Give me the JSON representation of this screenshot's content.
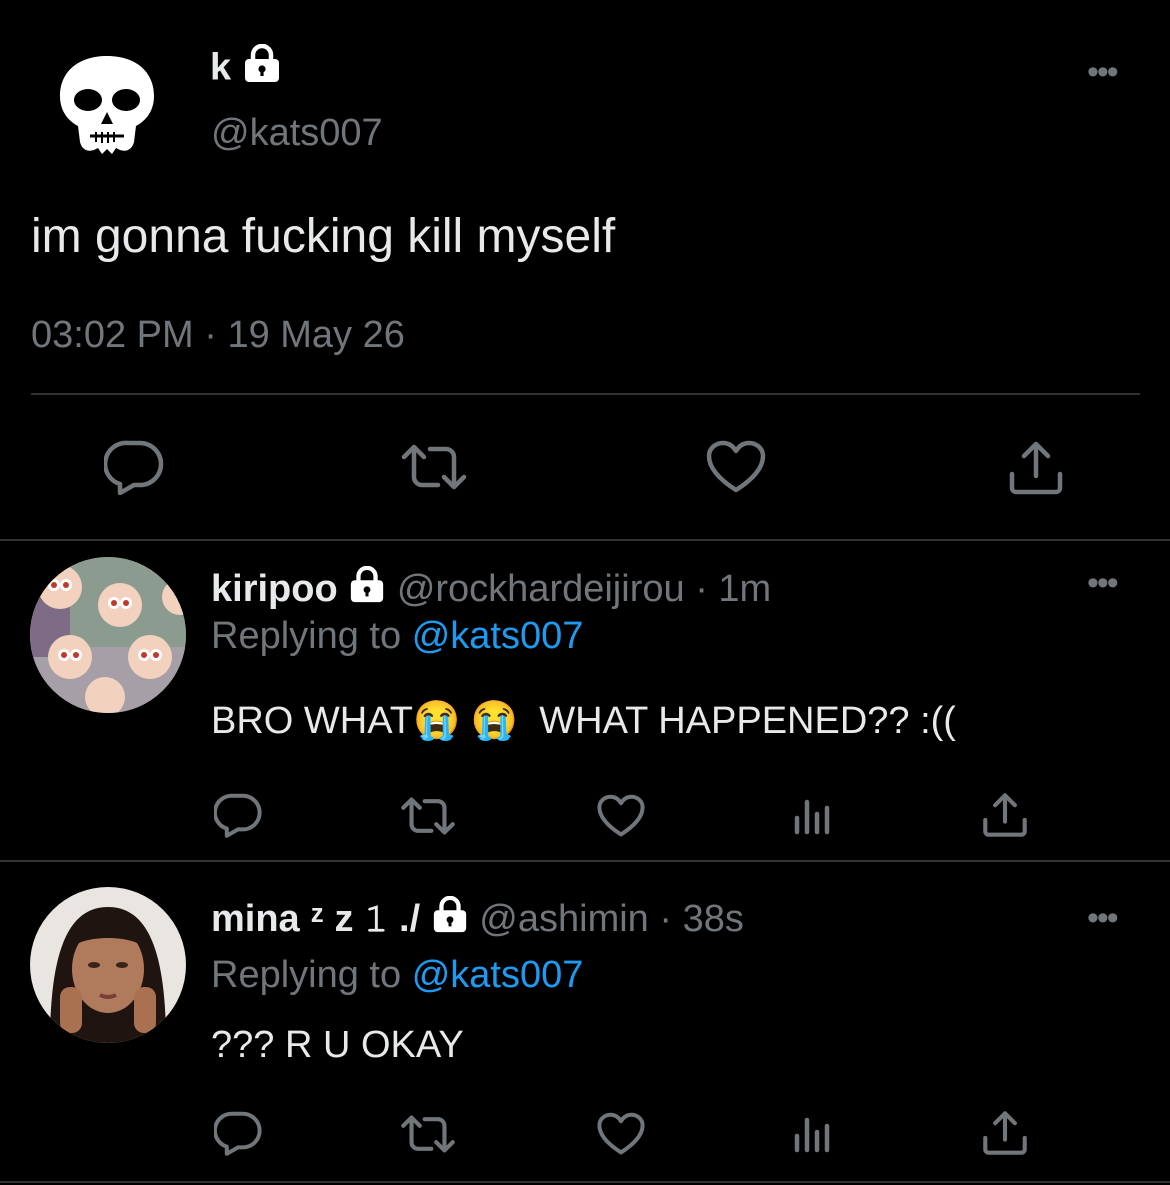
{
  "main_tweet": {
    "display_name": "k",
    "handle": "@kats007",
    "text": "im gonna fucking kill myself",
    "time": "03:02 PM",
    "separator": "·",
    "date": "19 May 26"
  },
  "replies": [
    {
      "display_name": "kiripoo",
      "handle": "@rockhardeijirou",
      "separator": "·",
      "time": "1m",
      "replying_prefix": "Replying to",
      "replying_to": "@kats007",
      "text_part1": "BRO WHAT",
      "emoji1": "😭",
      "emoji2": "😭",
      "text_part2": "WHAT HAPPENED?? :(("
    },
    {
      "display_name": "mina ᶻ z 𝟷 ./",
      "handle": "@ashimin",
      "separator": "·",
      "time": "38s",
      "replying_prefix": "Replying to",
      "replying_to": "@kats007",
      "text": "??? R U OKAY"
    }
  ],
  "colors": {
    "background": "#000000",
    "text": "#e7e9ea",
    "secondary": "#71767b",
    "accent": "#1d9bf0",
    "divider": "#2f3336"
  },
  "icons": {
    "more": "more-dots-icon",
    "reply": "reply-bubble-icon",
    "retweet": "retweet-icon",
    "like": "heart-icon",
    "views": "analytics-bars-icon",
    "share": "share-icon",
    "lock": "lock-icon",
    "avatar_main": "skull-avatar"
  }
}
